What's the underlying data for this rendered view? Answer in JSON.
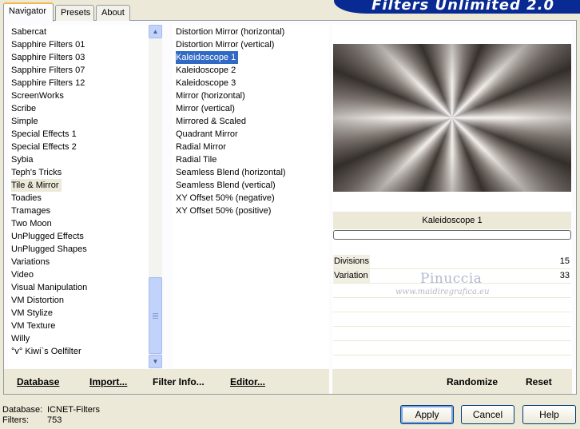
{
  "banner": {
    "title": "Filters Unlimited 2.0"
  },
  "tabs": [
    {
      "label": "Navigator",
      "active": true
    },
    {
      "label": "Presets",
      "active": false
    },
    {
      "label": "About",
      "active": false
    }
  ],
  "categories": {
    "selected": "Tile & Mirror",
    "items": [
      "Sabercat",
      "Sapphire Filters 01",
      "Sapphire Filters 03",
      "Sapphire Filters 07",
      "Sapphire Filters 12",
      "ScreenWorks",
      "Scribe",
      "Simple",
      "Special Effects 1",
      "Special Effects 2",
      "Sybia",
      "Teph's Tricks",
      "Tile & Mirror",
      "Toadies",
      "Tramages",
      "Two Moon",
      "UnPlugged Effects",
      "UnPlugged Shapes",
      "Variations",
      "Video",
      "Visual Manipulation",
      "VM Distortion",
      "VM Stylize",
      "VM Texture",
      "Willy",
      "°v° Kiwi`s Oelfilter"
    ]
  },
  "filters": {
    "selected": "Kaleidoscope 1",
    "items": [
      "Distortion Mirror (horizontal)",
      "Distortion Mirror (vertical)",
      "Kaleidoscope 1",
      "Kaleidoscope 2",
      "Kaleidoscope 3",
      "Mirror (horizontal)",
      "Mirror (vertical)",
      "Mirrored & Scaled",
      "Quadrant Mirror",
      "Radial Mirror",
      "Radial Tile",
      "Seamless Blend (horizontal)",
      "Seamless Blend (vertical)",
      "XY Offset 50% (negative)",
      "XY Offset 50% (positive)"
    ]
  },
  "preview": {
    "filter_name": "Kaleidoscope 1",
    "progress": 0
  },
  "params": [
    {
      "label": "Divisions",
      "value": "15"
    },
    {
      "label": "Variation",
      "value": "33"
    }
  ],
  "watermark": {
    "name": "Pinuccia",
    "url": "www.maidiregrafica.eu"
  },
  "toolbar": {
    "database": "Database",
    "import": "Import...",
    "filter_info": "Filter Info...",
    "editor": "Editor...",
    "randomize": "Randomize",
    "reset": "Reset"
  },
  "status": {
    "database_label": "Database:",
    "database_value": "ICNET-Filters",
    "filters_label": "Filters:",
    "filters_value": "753"
  },
  "buttons": {
    "apply": "Apply",
    "cancel": "Cancel",
    "help": "Help"
  }
}
